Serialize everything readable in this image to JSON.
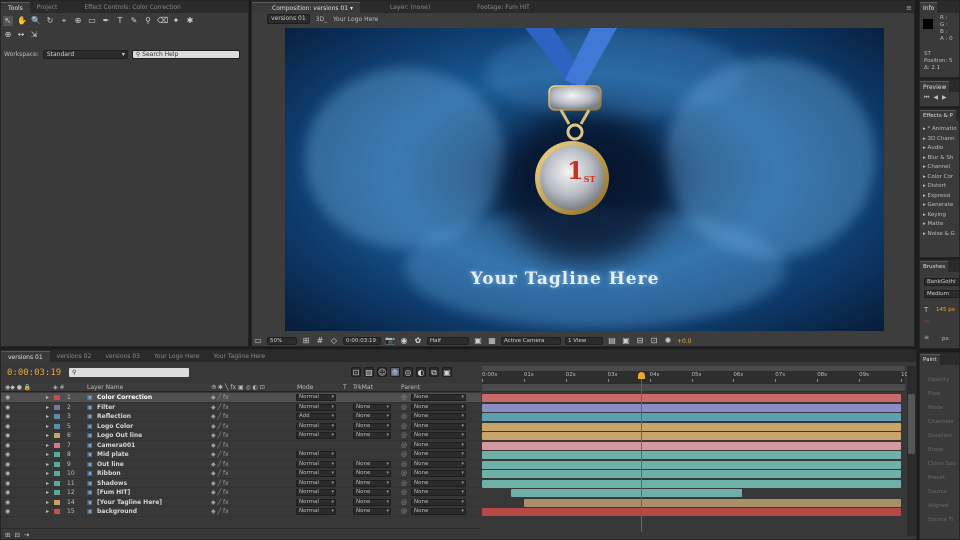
{
  "tools_panel": {
    "tabs": [
      "Tools",
      "Project",
      "Effect Controls: Color Correction"
    ],
    "workspace_label": "Workspace:",
    "workspace_value": "Standard",
    "search_placeholder": "Search Help"
  },
  "comp_panel": {
    "tabs": [
      "Composition: versions 01",
      "Layer: (none)",
      "Footage: Fum HIT"
    ],
    "breadcrumbs": [
      "versions 01",
      "3D_",
      "Your Logo Here"
    ],
    "medal_text": "1",
    "medal_sup": "ST",
    "tagline": "Your Tagline Here",
    "zoom": "50%",
    "timecode": "0:00:03:19",
    "resolution": "Half",
    "camera": "Active Camera",
    "views": "1 View",
    "exposure": "+0.0"
  },
  "info_panel": {
    "tab": "Info",
    "rgb_labels": [
      "R :",
      "G :",
      "B :",
      "A : 0"
    ],
    "lines": [
      "ST",
      "Position: 5",
      "Δ: 2.1"
    ]
  },
  "preview_panel": {
    "tab": "Preview"
  },
  "effects_panel": {
    "tab": "Effects & P",
    "items": [
      "* Animatio",
      "3D Chann",
      "Audio",
      "Blur & Sh",
      "Channel",
      "Color Cor",
      "Distort",
      "Expressi",
      "Generate",
      "Keying",
      "Matte",
      "Noise & G"
    ]
  },
  "brushes_panel": {
    "tab": "Brushes",
    "font": "BankGothi",
    "style": "Medium",
    "size": "145 px",
    "px": "px"
  },
  "paint_panel": {
    "tab": "Paint",
    "labels": [
      "Opacity",
      "Flow",
      "Mode",
      "Channels",
      "Duration",
      "Erase",
      "Clone Sou",
      "Preset",
      "Source",
      "Aligned",
      "Source Ti"
    ]
  },
  "timeline": {
    "tabs": [
      "versions 01",
      "versions 02",
      "versions 03",
      "Your Logo Here",
      "Your Tagline Here"
    ],
    "timecode": "0:00:03:19",
    "search_placeholder": "",
    "col_layer_name": "Layer Name",
    "col_mode": "Mode",
    "col_t": "T",
    "col_trkmat": "TrkMat",
    "col_parent": "Parent",
    "ruler": [
      "0:00s",
      "01s",
      "02s",
      "03s",
      "04s",
      "05s",
      "06s",
      "07s",
      "08s",
      "09s",
      "10"
    ],
    "playhead_seconds": 3.8,
    "layers": [
      {
        "num": "1",
        "name": "Color Correction",
        "mode": "Normal",
        "trkmat": "",
        "parent": "None",
        "color": "#c94e4e",
        "bar": [
          0,
          10
        ],
        "bar_color": "#c96a6a",
        "selected": true
      },
      {
        "num": "2",
        "name": "Filter",
        "mode": "Normal",
        "trkmat": "None",
        "parent": "None",
        "color": "#6f78a6",
        "bar": [
          0,
          10
        ],
        "bar_color": "#8a8ec4"
      },
      {
        "num": "3",
        "name": "Reflection",
        "mode": "Add",
        "trkmat": "None",
        "parent": "None",
        "color": "#5c8fa6",
        "bar": [
          0,
          10
        ],
        "bar_color": "#5fa0b0"
      },
      {
        "num": "5",
        "name": "Logo Color",
        "mode": "Normal",
        "trkmat": "None",
        "parent": "None",
        "color": "#5c8fa6",
        "bar": [
          0,
          10
        ],
        "bar_color": "#c9a46a"
      },
      {
        "num": "6",
        "name": "Logo Out line",
        "mode": "Normal",
        "trkmat": "None",
        "parent": "None",
        "color": "#c9a46a",
        "bar": [
          0,
          10
        ],
        "bar_color": "#c9a46a"
      },
      {
        "num": "7",
        "name": "Camera001",
        "mode": "",
        "trkmat": "",
        "parent": "None",
        "color": "#c97a8a",
        "bar": [
          0,
          10
        ],
        "bar_color": "#d49aa0"
      },
      {
        "num": "8",
        "name": "Mid plate",
        "mode": "Normal",
        "trkmat": "",
        "parent": "None",
        "color": "#5ca6a0",
        "bar": [
          0,
          10
        ],
        "bar_color": "#6fb0a8"
      },
      {
        "num": "9",
        "name": "Out line",
        "mode": "Normal",
        "trkmat": "None",
        "parent": "None",
        "color": "#5ca6a0",
        "bar": [
          0,
          10
        ],
        "bar_color": "#6fb0a8"
      },
      {
        "num": "10",
        "name": "Ribbon",
        "mode": "Normal",
        "trkmat": "None",
        "parent": "None",
        "color": "#5ca6a0",
        "bar": [
          0,
          10
        ],
        "bar_color": "#6fb0a8"
      },
      {
        "num": "11",
        "name": "Shadows",
        "mode": "Normal",
        "trkmat": "None",
        "parent": "None",
        "color": "#5ca6a0",
        "bar": [
          0,
          10
        ],
        "bar_color": "#6fb0a8"
      },
      {
        "num": "12",
        "name": "[Fum HIT]",
        "mode": "Normal",
        "trkmat": "None",
        "parent": "None",
        "color": "#5ca6a0",
        "bar": [
          0.7,
          6.2
        ],
        "bar_color": "#6fb0a8"
      },
      {
        "num": "14",
        "name": "[Your Tagline Here]",
        "mode": "Normal",
        "trkmat": "None",
        "parent": "None",
        "color": "#c9a46a",
        "bar": [
          1.0,
          10
        ],
        "bar_color": "#a8906a"
      },
      {
        "num": "15",
        "name": "background",
        "mode": "Normal",
        "trkmat": "None",
        "parent": "None",
        "color": "#c94e4e",
        "bar": [
          0,
          10
        ],
        "bar_color": "#b84848"
      }
    ]
  },
  "colors": {
    "accent": "#e8a93a",
    "playhead": "#e03030",
    "panel": "#3a3a3a"
  }
}
